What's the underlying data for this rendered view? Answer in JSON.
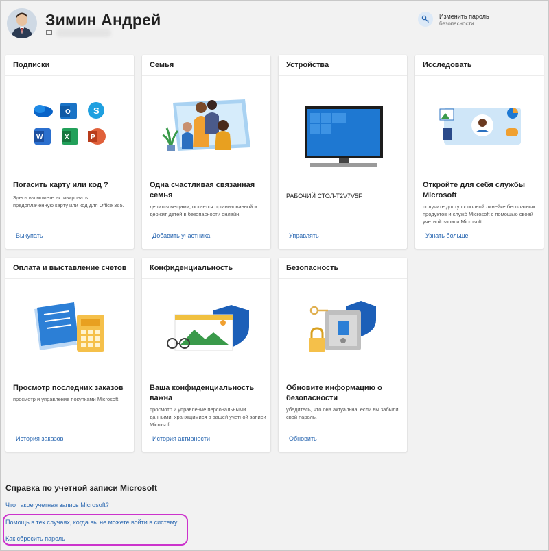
{
  "header": {
    "user_name": "Зимин Андрей",
    "change_password_title": "Изменить пароль",
    "change_password_sub": "безопасности"
  },
  "cards": [
    {
      "title": "Подписки",
      "heading": "Погасить карту или код ?",
      "description": "Здесь вы можете активировать предоплаченную карту или код для Office 365.",
      "link": "Выкупать"
    },
    {
      "title": "Семья",
      "heading": "Одна счастливая связанная семья",
      "description": "делится вещами, остается организованной и держит детей в безопасности онлайн.",
      "link": "Добавить участника"
    },
    {
      "title": "Устройства",
      "heading": "РАБОЧИЙ СТОЛ-T2V7V5F",
      "description": "",
      "link": "Управлять"
    },
    {
      "title": "Исследовать",
      "heading": "Откройте для себя службы Microsoft",
      "description": "получите доступ к полной линейке бесплатных продуктов и служб Microsoft с помощью своей учетной записи Microsoft.",
      "link": "Узнать больше"
    },
    {
      "title": "Оплата и выставление счетов",
      "heading": "Просмотр последних заказов",
      "description": "просмотр и управление покупками Microsoft.",
      "link": "История заказов"
    },
    {
      "title": "Конфиденциальность",
      "heading": "Ваша конфиденциальность важна",
      "description": "просмотр и управление персональными данными, хранящимися в вашей учетной записи Microsoft.",
      "link": "История активности"
    },
    {
      "title": "Безопасность",
      "heading": "Обновите информацию о безопасности",
      "description": "убедитесь, что она актуальна, если вы забыли свой пароль.",
      "link": "Обновить"
    }
  ],
  "help": {
    "title": "Справка по учетной записи Microsoft",
    "links": [
      "Что такое учетная запись Microsoft?",
      "Помощь в тех случаях, когда вы не можете войти в систему",
      "Как сбросить пароль"
    ]
  },
  "colors": {
    "link": "#2866b0",
    "highlight": "#cc33cc",
    "accent": "#0078d4"
  }
}
